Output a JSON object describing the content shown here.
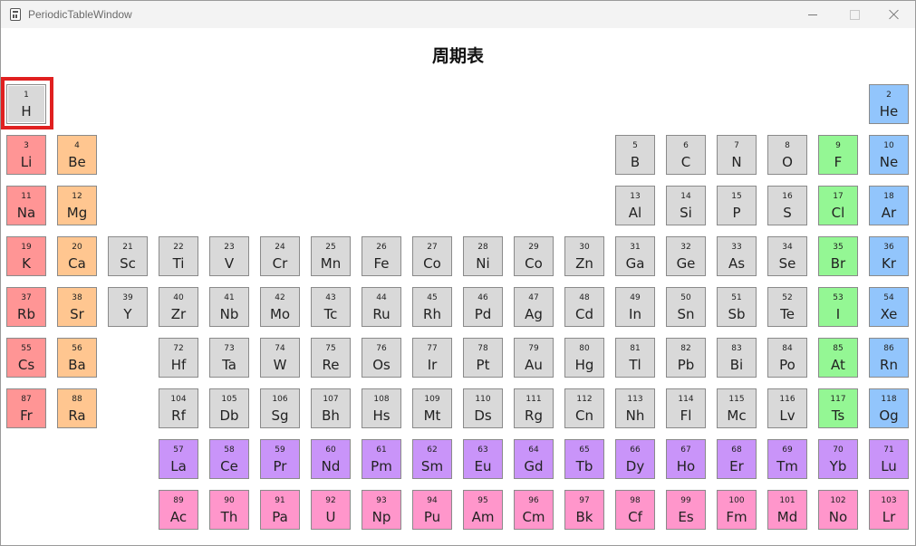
{
  "window": {
    "title": "PeriodicTableWindow"
  },
  "page": {
    "title": "周期表"
  },
  "colors": {
    "alkali": "#ff9595",
    "alkaline": "#ffc690",
    "other": "#d9d9d9",
    "halogen": "#94f794",
    "noble": "#92c5fc",
    "lanthanoid": "#c994f9",
    "actinoid": "#ff96cb",
    "hydrogen": "#d9d9d9",
    "selection": "#e02020"
  },
  "selected_element": "H",
  "elements": [
    {
      "n": "1",
      "s": "H",
      "row": 0,
      "col": 0,
      "cat": "hydrogen"
    },
    {
      "n": "2",
      "s": "He",
      "row": 0,
      "col": 17,
      "cat": "noble"
    },
    {
      "n": "3",
      "s": "Li",
      "row": 1,
      "col": 0,
      "cat": "alkali"
    },
    {
      "n": "4",
      "s": "Be",
      "row": 1,
      "col": 1,
      "cat": "alkaline"
    },
    {
      "n": "5",
      "s": "B",
      "row": 1,
      "col": 12,
      "cat": "other"
    },
    {
      "n": "6",
      "s": "C",
      "row": 1,
      "col": 13,
      "cat": "other"
    },
    {
      "n": "7",
      "s": "N",
      "row": 1,
      "col": 14,
      "cat": "other"
    },
    {
      "n": "8",
      "s": "O",
      "row": 1,
      "col": 15,
      "cat": "other"
    },
    {
      "n": "9",
      "s": "F",
      "row": 1,
      "col": 16,
      "cat": "halogen"
    },
    {
      "n": "10",
      "s": "Ne",
      "row": 1,
      "col": 17,
      "cat": "noble"
    },
    {
      "n": "11",
      "s": "Na",
      "row": 2,
      "col": 0,
      "cat": "alkali"
    },
    {
      "n": "12",
      "s": "Mg",
      "row": 2,
      "col": 1,
      "cat": "alkaline"
    },
    {
      "n": "13",
      "s": "Al",
      "row": 2,
      "col": 12,
      "cat": "other"
    },
    {
      "n": "14",
      "s": "Si",
      "row": 2,
      "col": 13,
      "cat": "other"
    },
    {
      "n": "15",
      "s": "P",
      "row": 2,
      "col": 14,
      "cat": "other"
    },
    {
      "n": "16",
      "s": "S",
      "row": 2,
      "col": 15,
      "cat": "other"
    },
    {
      "n": "17",
      "s": "Cl",
      "row": 2,
      "col": 16,
      "cat": "halogen"
    },
    {
      "n": "18",
      "s": "Ar",
      "row": 2,
      "col": 17,
      "cat": "noble"
    },
    {
      "n": "19",
      "s": "K",
      "row": 3,
      "col": 0,
      "cat": "alkali"
    },
    {
      "n": "20",
      "s": "Ca",
      "row": 3,
      "col": 1,
      "cat": "alkaline"
    },
    {
      "n": "21",
      "s": "Sc",
      "row": 3,
      "col": 2,
      "cat": "other"
    },
    {
      "n": "22",
      "s": "Ti",
      "row": 3,
      "col": 3,
      "cat": "other"
    },
    {
      "n": "23",
      "s": "V",
      "row": 3,
      "col": 4,
      "cat": "other"
    },
    {
      "n": "24",
      "s": "Cr",
      "row": 3,
      "col": 5,
      "cat": "other"
    },
    {
      "n": "25",
      "s": "Mn",
      "row": 3,
      "col": 6,
      "cat": "other"
    },
    {
      "n": "26",
      "s": "Fe",
      "row": 3,
      "col": 7,
      "cat": "other"
    },
    {
      "n": "27",
      "s": "Co",
      "row": 3,
      "col": 8,
      "cat": "other"
    },
    {
      "n": "28",
      "s": "Ni",
      "row": 3,
      "col": 9,
      "cat": "other"
    },
    {
      "n": "29",
      "s": "Co",
      "row": 3,
      "col": 10,
      "cat": "other"
    },
    {
      "n": "30",
      "s": "Zn",
      "row": 3,
      "col": 11,
      "cat": "other"
    },
    {
      "n": "31",
      "s": "Ga",
      "row": 3,
      "col": 12,
      "cat": "other"
    },
    {
      "n": "32",
      "s": "Ge",
      "row": 3,
      "col": 13,
      "cat": "other"
    },
    {
      "n": "33",
      "s": "As",
      "row": 3,
      "col": 14,
      "cat": "other"
    },
    {
      "n": "34",
      "s": "Se",
      "row": 3,
      "col": 15,
      "cat": "other"
    },
    {
      "n": "35",
      "s": "Br",
      "row": 3,
      "col": 16,
      "cat": "halogen"
    },
    {
      "n": "36",
      "s": "Kr",
      "row": 3,
      "col": 17,
      "cat": "noble"
    },
    {
      "n": "37",
      "s": "Rb",
      "row": 4,
      "col": 0,
      "cat": "alkali"
    },
    {
      "n": "38",
      "s": "Sr",
      "row": 4,
      "col": 1,
      "cat": "alkaline"
    },
    {
      "n": "39",
      "s": "Y",
      "row": 4,
      "col": 2,
      "cat": "other"
    },
    {
      "n": "40",
      "s": "Zr",
      "row": 4,
      "col": 3,
      "cat": "other"
    },
    {
      "n": "41",
      "s": "Nb",
      "row": 4,
      "col": 4,
      "cat": "other"
    },
    {
      "n": "42",
      "s": "Mo",
      "row": 4,
      "col": 5,
      "cat": "other"
    },
    {
      "n": "43",
      "s": "Tc",
      "row": 4,
      "col": 6,
      "cat": "other"
    },
    {
      "n": "44",
      "s": "Ru",
      "row": 4,
      "col": 7,
      "cat": "other"
    },
    {
      "n": "45",
      "s": "Rh",
      "row": 4,
      "col": 8,
      "cat": "other"
    },
    {
      "n": "46",
      "s": "Pd",
      "row": 4,
      "col": 9,
      "cat": "other"
    },
    {
      "n": "47",
      "s": "Ag",
      "row": 4,
      "col": 10,
      "cat": "other"
    },
    {
      "n": "48",
      "s": "Cd",
      "row": 4,
      "col": 11,
      "cat": "other"
    },
    {
      "n": "49",
      "s": "In",
      "row": 4,
      "col": 12,
      "cat": "other"
    },
    {
      "n": "50",
      "s": "Sn",
      "row": 4,
      "col": 13,
      "cat": "other"
    },
    {
      "n": "51",
      "s": "Sb",
      "row": 4,
      "col": 14,
      "cat": "other"
    },
    {
      "n": "52",
      "s": "Te",
      "row": 4,
      "col": 15,
      "cat": "other"
    },
    {
      "n": "53",
      "s": "I",
      "row": 4,
      "col": 16,
      "cat": "halogen"
    },
    {
      "n": "54",
      "s": "Xe",
      "row": 4,
      "col": 17,
      "cat": "noble"
    },
    {
      "n": "55",
      "s": "Cs",
      "row": 5,
      "col": 0,
      "cat": "alkali"
    },
    {
      "n": "56",
      "s": "Ba",
      "row": 5,
      "col": 1,
      "cat": "alkaline"
    },
    {
      "n": "72",
      "s": "Hf",
      "row": 5,
      "col": 3,
      "cat": "other"
    },
    {
      "n": "73",
      "s": "Ta",
      "row": 5,
      "col": 4,
      "cat": "other"
    },
    {
      "n": "74",
      "s": "W",
      "row": 5,
      "col": 5,
      "cat": "other"
    },
    {
      "n": "75",
      "s": "Re",
      "row": 5,
      "col": 6,
      "cat": "other"
    },
    {
      "n": "76",
      "s": "Os",
      "row": 5,
      "col": 7,
      "cat": "other"
    },
    {
      "n": "77",
      "s": "Ir",
      "row": 5,
      "col": 8,
      "cat": "other"
    },
    {
      "n": "78",
      "s": "Pt",
      "row": 5,
      "col": 9,
      "cat": "other"
    },
    {
      "n": "79",
      "s": "Au",
      "row": 5,
      "col": 10,
      "cat": "other"
    },
    {
      "n": "80",
      "s": "Hg",
      "row": 5,
      "col": 11,
      "cat": "other"
    },
    {
      "n": "81",
      "s": "Tl",
      "row": 5,
      "col": 12,
      "cat": "other"
    },
    {
      "n": "82",
      "s": "Pb",
      "row": 5,
      "col": 13,
      "cat": "other"
    },
    {
      "n": "83",
      "s": "Bi",
      "row": 5,
      "col": 14,
      "cat": "other"
    },
    {
      "n": "84",
      "s": "Po",
      "row": 5,
      "col": 15,
      "cat": "other"
    },
    {
      "n": "85",
      "s": "At",
      "row": 5,
      "col": 16,
      "cat": "halogen"
    },
    {
      "n": "86",
      "s": "Rn",
      "row": 5,
      "col": 17,
      "cat": "noble"
    },
    {
      "n": "87",
      "s": "Fr",
      "row": 6,
      "col": 0,
      "cat": "alkali"
    },
    {
      "n": "88",
      "s": "Ra",
      "row": 6,
      "col": 1,
      "cat": "alkaline"
    },
    {
      "n": "104",
      "s": "Rf",
      "row": 6,
      "col": 3,
      "cat": "other"
    },
    {
      "n": "105",
      "s": "Db",
      "row": 6,
      "col": 4,
      "cat": "other"
    },
    {
      "n": "106",
      "s": "Sg",
      "row": 6,
      "col": 5,
      "cat": "other"
    },
    {
      "n": "107",
      "s": "Bh",
      "row": 6,
      "col": 6,
      "cat": "other"
    },
    {
      "n": "108",
      "s": "Hs",
      "row": 6,
      "col": 7,
      "cat": "other"
    },
    {
      "n": "109",
      "s": "Mt",
      "row": 6,
      "col": 8,
      "cat": "other"
    },
    {
      "n": "110",
      "s": "Ds",
      "row": 6,
      "col": 9,
      "cat": "other"
    },
    {
      "n": "111",
      "s": "Rg",
      "row": 6,
      "col": 10,
      "cat": "other"
    },
    {
      "n": "112",
      "s": "Cn",
      "row": 6,
      "col": 11,
      "cat": "other"
    },
    {
      "n": "113",
      "s": "Nh",
      "row": 6,
      "col": 12,
      "cat": "other"
    },
    {
      "n": "114",
      "s": "Fl",
      "row": 6,
      "col": 13,
      "cat": "other"
    },
    {
      "n": "115",
      "s": "Mc",
      "row": 6,
      "col": 14,
      "cat": "other"
    },
    {
      "n": "116",
      "s": "Lv",
      "row": 6,
      "col": 15,
      "cat": "other"
    },
    {
      "n": "117",
      "s": "Ts",
      "row": 6,
      "col": 16,
      "cat": "halogen"
    },
    {
      "n": "118",
      "s": "Og",
      "row": 6,
      "col": 17,
      "cat": "noble"
    },
    {
      "n": "57",
      "s": "La",
      "row": 7,
      "col": 3,
      "cat": "lanthanoid"
    },
    {
      "n": "58",
      "s": "Ce",
      "row": 7,
      "col": 4,
      "cat": "lanthanoid"
    },
    {
      "n": "59",
      "s": "Pr",
      "row": 7,
      "col": 5,
      "cat": "lanthanoid"
    },
    {
      "n": "60",
      "s": "Nd",
      "row": 7,
      "col": 6,
      "cat": "lanthanoid"
    },
    {
      "n": "61",
      "s": "Pm",
      "row": 7,
      "col": 7,
      "cat": "lanthanoid"
    },
    {
      "n": "62",
      "s": "Sm",
      "row": 7,
      "col": 8,
      "cat": "lanthanoid"
    },
    {
      "n": "63",
      "s": "Eu",
      "row": 7,
      "col": 9,
      "cat": "lanthanoid"
    },
    {
      "n": "64",
      "s": "Gd",
      "row": 7,
      "col": 10,
      "cat": "lanthanoid"
    },
    {
      "n": "65",
      "s": "Tb",
      "row": 7,
      "col": 11,
      "cat": "lanthanoid"
    },
    {
      "n": "66",
      "s": "Dy",
      "row": 7,
      "col": 12,
      "cat": "lanthanoid"
    },
    {
      "n": "67",
      "s": "Ho",
      "row": 7,
      "col": 13,
      "cat": "lanthanoid"
    },
    {
      "n": "68",
      "s": "Er",
      "row": 7,
      "col": 14,
      "cat": "lanthanoid"
    },
    {
      "n": "69",
      "s": "Tm",
      "row": 7,
      "col": 15,
      "cat": "lanthanoid"
    },
    {
      "n": "70",
      "s": "Yb",
      "row": 7,
      "col": 16,
      "cat": "lanthanoid"
    },
    {
      "n": "71",
      "s": "Lu",
      "row": 7,
      "col": 17,
      "cat": "lanthanoid"
    },
    {
      "n": "89",
      "s": "Ac",
      "row": 8,
      "col": 3,
      "cat": "actinoid"
    },
    {
      "n": "90",
      "s": "Th",
      "row": 8,
      "col": 4,
      "cat": "actinoid"
    },
    {
      "n": "91",
      "s": "Pa",
      "row": 8,
      "col": 5,
      "cat": "actinoid"
    },
    {
      "n": "92",
      "s": "U",
      "row": 8,
      "col": 6,
      "cat": "actinoid"
    },
    {
      "n": "93",
      "s": "Np",
      "row": 8,
      "col": 7,
      "cat": "actinoid"
    },
    {
      "n": "94",
      "s": "Pu",
      "row": 8,
      "col": 8,
      "cat": "actinoid"
    },
    {
      "n": "95",
      "s": "Am",
      "row": 8,
      "col": 9,
      "cat": "actinoid"
    },
    {
      "n": "96",
      "s": "Cm",
      "row": 8,
      "col": 10,
      "cat": "actinoid"
    },
    {
      "n": "97",
      "s": "Bk",
      "row": 8,
      "col": 11,
      "cat": "actinoid"
    },
    {
      "n": "98",
      "s": "Cf",
      "row": 8,
      "col": 12,
      "cat": "actinoid"
    },
    {
      "n": "99",
      "s": "Es",
      "row": 8,
      "col": 13,
      "cat": "actinoid"
    },
    {
      "n": "100",
      "s": "Fm",
      "row": 8,
      "col": 14,
      "cat": "actinoid"
    },
    {
      "n": "101",
      "s": "Md",
      "row": 8,
      "col": 15,
      "cat": "actinoid"
    },
    {
      "n": "102",
      "s": "No",
      "row": 8,
      "col": 16,
      "cat": "actinoid"
    },
    {
      "n": "103",
      "s": "Lr",
      "row": 8,
      "col": 17,
      "cat": "actinoid"
    }
  ]
}
